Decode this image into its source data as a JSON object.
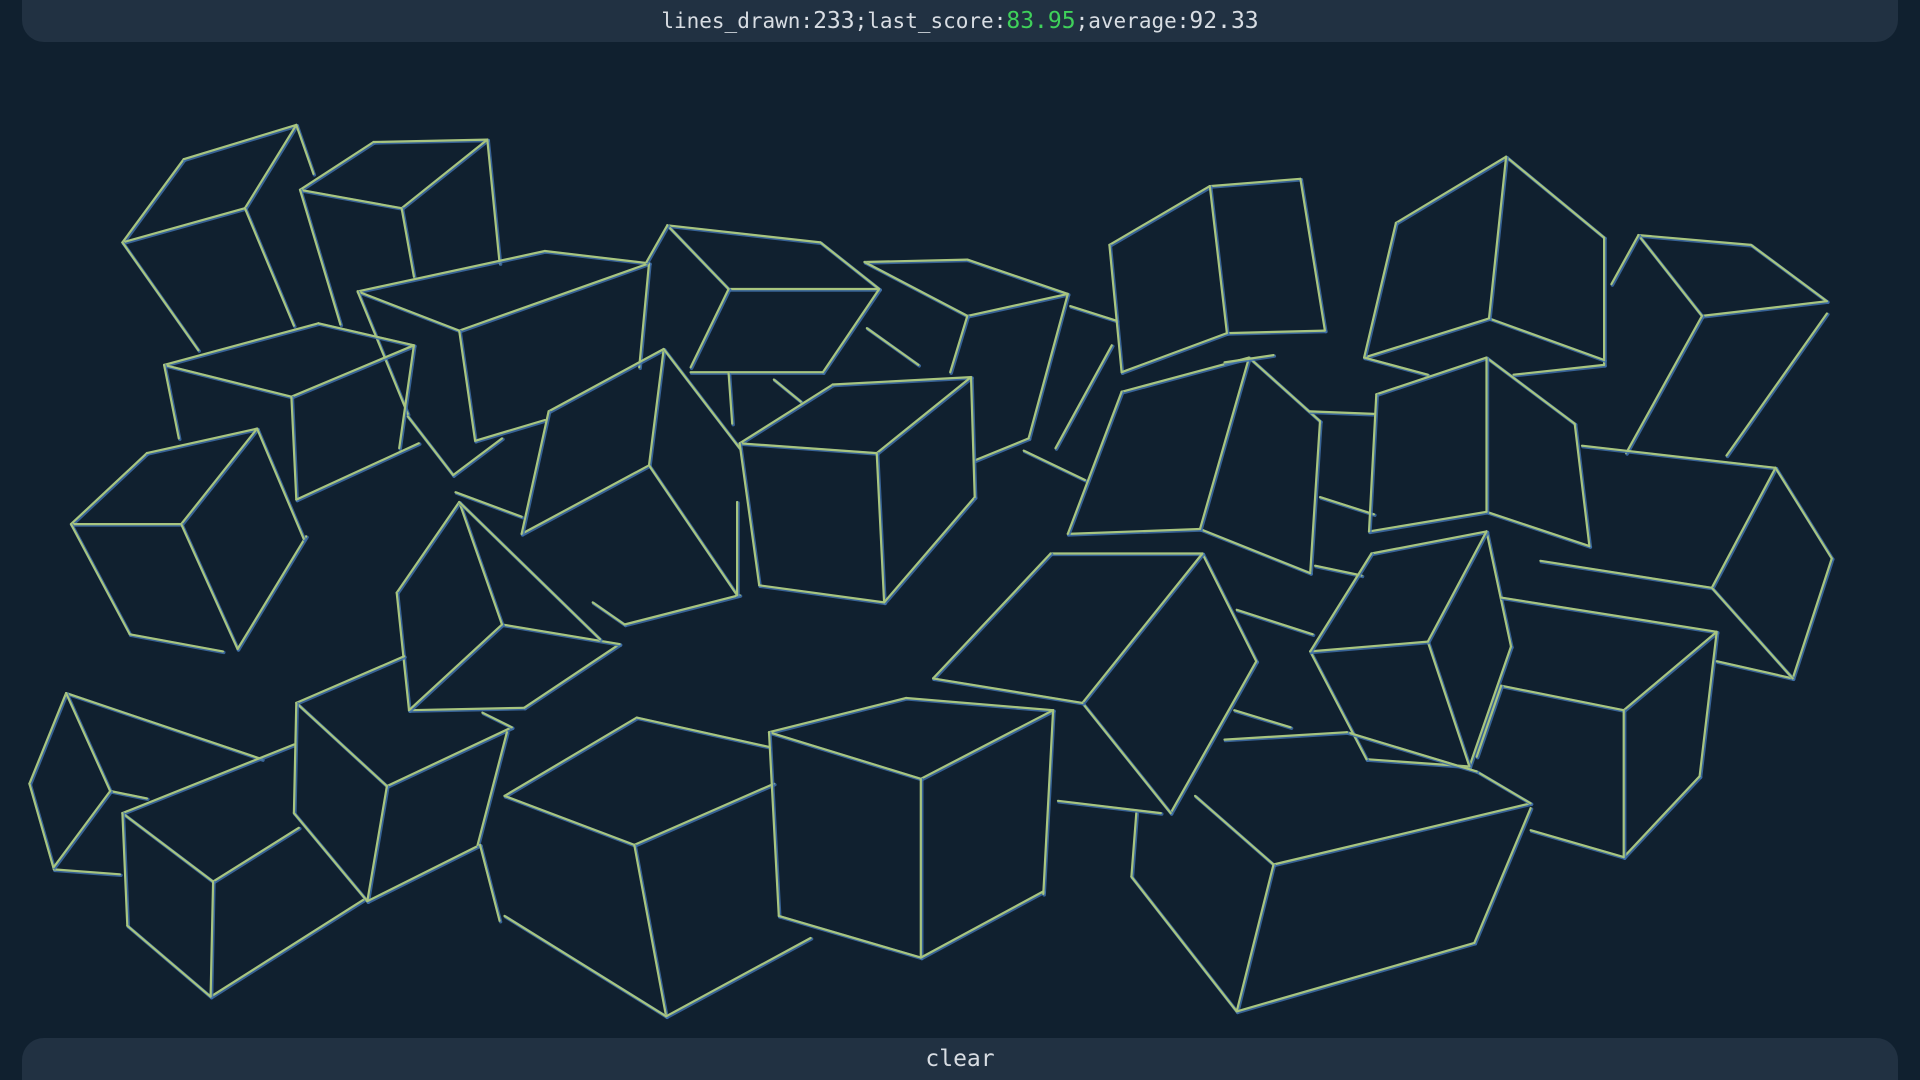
{
  "stats": {
    "lines_label": "lines_drawn:",
    "lines_value": "233",
    "sep1": ";",
    "score_label": "last_score:",
    "score_value": "83.95",
    "sep2": ";",
    "avg_label": "average:",
    "avg_value": "92.33",
    "score_color": "#3fd15a"
  },
  "clear_label": "clear",
  "stroke_colors": {
    "line": "#a8c57f",
    "glow": "#3e6fa8"
  }
}
